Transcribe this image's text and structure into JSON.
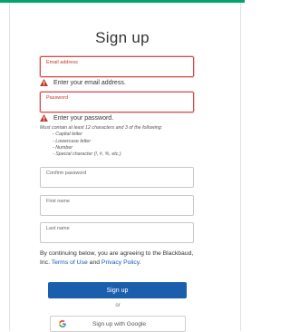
{
  "page": {
    "title": "Sign up",
    "accent_color": "#00a36c",
    "error_color": "#d84c4c",
    "link_color": "#1a57b6",
    "primary_color": "#1c5eae"
  },
  "form": {
    "email": {
      "label": "Email address",
      "value": "",
      "error": "Enter your email address."
    },
    "password": {
      "label": "Password",
      "value": "",
      "error": "Enter your password.",
      "hint_intro": "Must contain at least 12 characters and 3 of the following:",
      "hint_items": [
        "- Capital letter",
        "- Lowercase letter",
        "- Number",
        "- Special character (!, #, %, etc.)"
      ]
    },
    "confirm_password": {
      "label": "Confirm password",
      "value": ""
    },
    "first_name": {
      "label": "First name",
      "value": ""
    },
    "last_name": {
      "label": "Last name",
      "value": ""
    }
  },
  "terms": {
    "prefix": "By continuing below, you are agreeing to the Blackbaud, Inc.",
    "terms_link": "Terms of Use",
    "and": "and",
    "privacy_link": "Privacy Policy",
    "suffix": "."
  },
  "actions": {
    "signup_label": "Sign up",
    "or_label": "or",
    "google_label": "Sign up with Google",
    "google_icon": "google-g-icon"
  }
}
